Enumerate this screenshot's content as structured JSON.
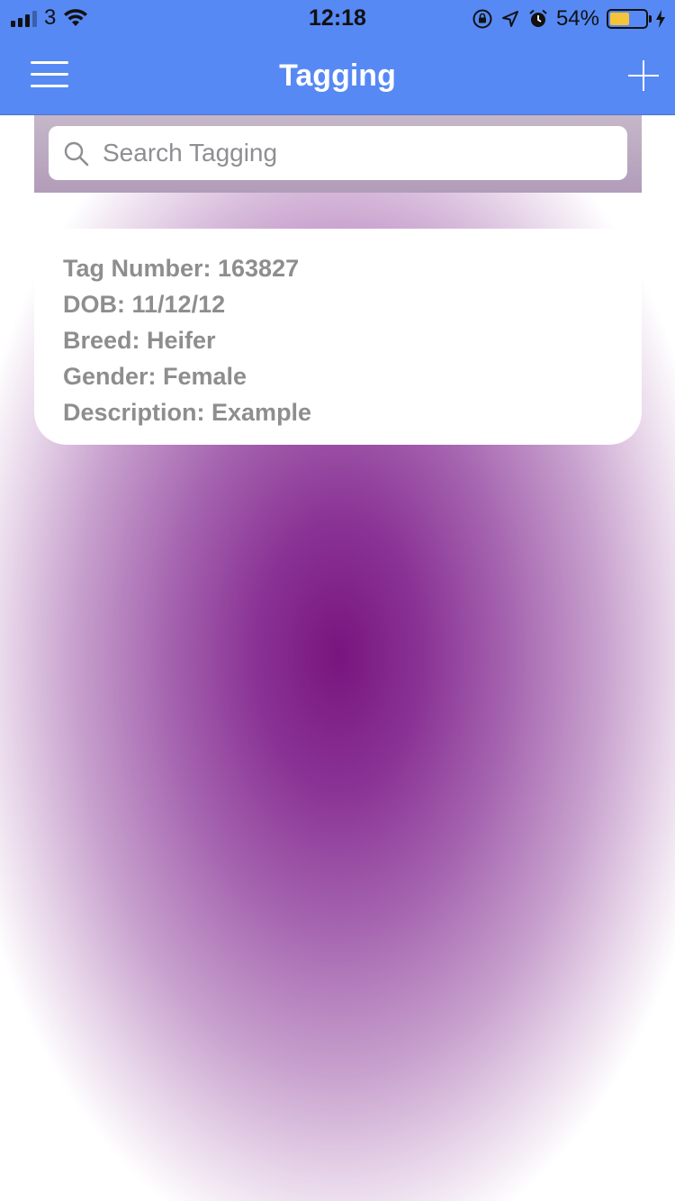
{
  "status_bar": {
    "carrier": "3",
    "time": "12:18",
    "battery": "54%",
    "battery_level": 0.54,
    "icons": [
      "signal-bars-icon",
      "wifi-icon",
      "orientation-lock-icon",
      "location-arrow-icon",
      "alarm-icon",
      "battery-icon",
      "charging-bolt-icon"
    ]
  },
  "navbar": {
    "title": "Tagging",
    "left_icon": "hamburger-menu-icon",
    "right_icon": "plus-icon",
    "color": "#5689f4"
  },
  "search": {
    "placeholder": "Search Tagging",
    "value": ""
  },
  "cards": [
    {
      "tag_number": "Tag Number: 163827",
      "dob": "DOB: 11/12/12",
      "breed": "Breed: Heifer",
      "gender": "Gender: Female",
      "description": "Description: Example"
    }
  ],
  "colors": {
    "background_center": "#78157e",
    "card_text": "#8e8e8e"
  }
}
